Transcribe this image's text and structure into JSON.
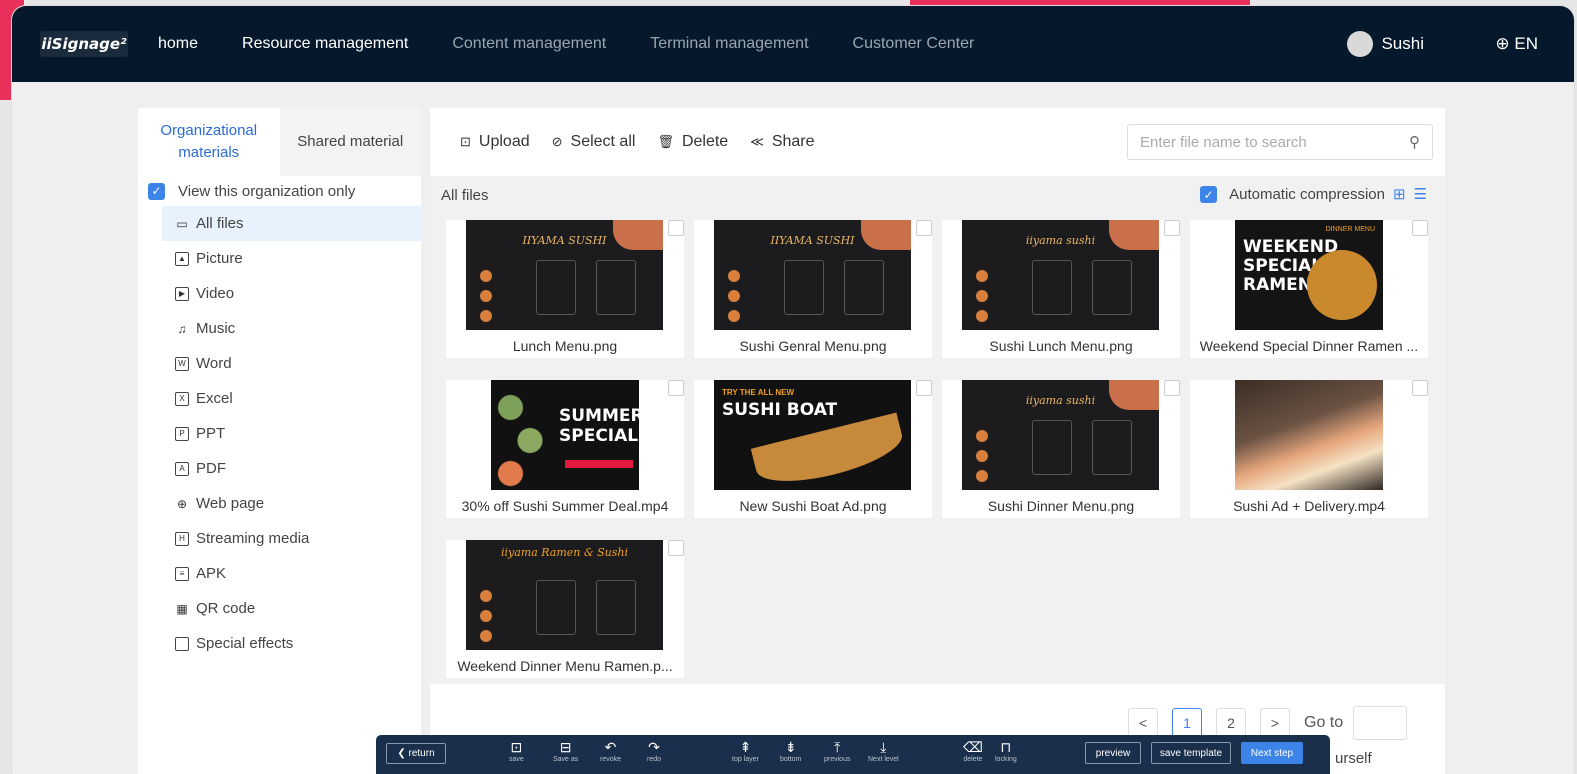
{
  "app": {
    "logo": "iiSignage²"
  },
  "nav": {
    "items": [
      "home",
      "Resource management",
      "Content management",
      "Terminal management",
      "Customer Center"
    ]
  },
  "user": {
    "name": "Sushi"
  },
  "lang": {
    "label": "EN"
  },
  "sidebar": {
    "tabs": [
      "Organizational materials",
      "Shared material"
    ],
    "view_org_only": "View this organization only",
    "items": [
      "All files",
      "Picture",
      "Video",
      "Music",
      "Word",
      "Excel",
      "PPT",
      "PDF",
      "Web page",
      "Streaming media",
      "APK",
      "QR code",
      "Special effects"
    ]
  },
  "toolbar": {
    "upload": "Upload",
    "select_all": "Select all",
    "delete": "Delete",
    "share": "Share"
  },
  "search": {
    "placeholder": "Enter file name to search"
  },
  "files": {
    "heading": "All files",
    "auto_compression": "Automatic compression",
    "items": [
      {
        "name": "Lunch Menu.png",
        "thumb_title": "IIYAMA SUSHI"
      },
      {
        "name": "Sushi Genral Menu.png",
        "thumb_title": "IIYAMA SUSHI"
      },
      {
        "name": "Sushi Lunch Menu.png",
        "thumb_title": "iiyama sushi"
      },
      {
        "name": "Weekend Special Dinner Ramen ...",
        "thumb_title": "WEEKEND SPECIAL RAMEN",
        "thumb_tag": "DINNER MENU"
      },
      {
        "name": "30% off Sushi Summer Deal.mp4",
        "thumb_title": "SUMMER SPECIAL!!"
      },
      {
        "name": "New Sushi Boat Ad.png",
        "thumb_title": "SUSHI BOAT",
        "thumb_tag": "TRY THE ALL NEW"
      },
      {
        "name": "Sushi Dinner Menu.png",
        "thumb_title": "iiyama sushi"
      },
      {
        "name": "Sushi Ad + Delivery.mp4",
        "thumb_title": ""
      },
      {
        "name": "Weekend Dinner Menu Ramen.p...",
        "thumb_title": "iiyama Ramen & Sushi"
      }
    ]
  },
  "pagination": {
    "prev": "<",
    "pages": [
      "1",
      "2"
    ],
    "next": ">",
    "goto": "Go to"
  },
  "editor": {
    "return": "return",
    "tools": [
      "save",
      "Save as",
      "revoke",
      "redo",
      "top layer",
      "bottom",
      "previous",
      "Next level",
      "delete",
      "locking"
    ],
    "preview": "preview",
    "save_template": "save template",
    "next_step": "Next step"
  },
  "trailing_text": "urself"
}
